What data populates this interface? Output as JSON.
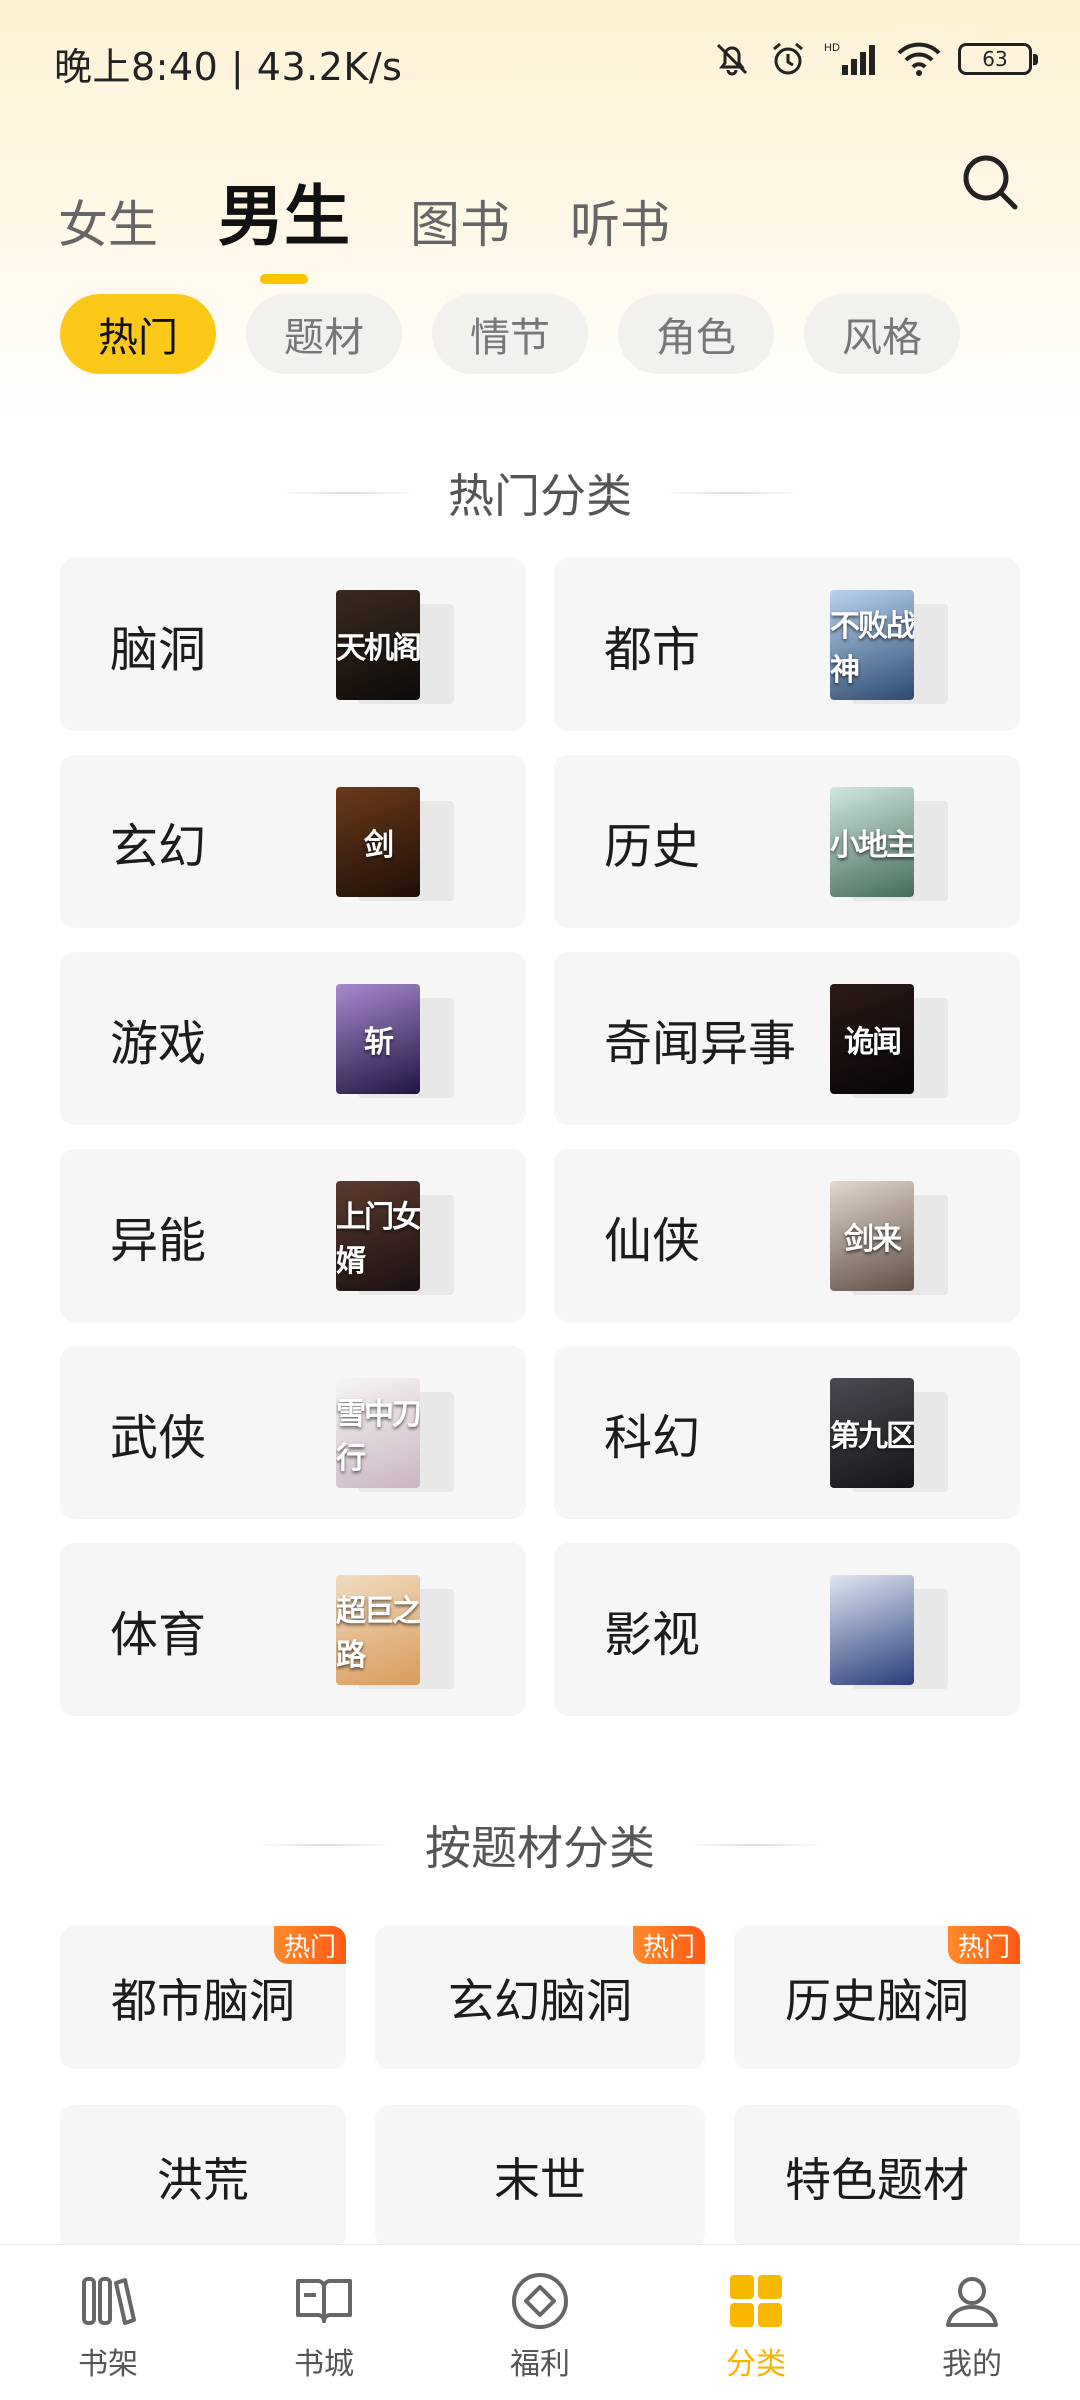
{
  "status": {
    "time": "晚上8:40 | 43.2K/s",
    "battery": "63"
  },
  "tabs": [
    {
      "label": "女生",
      "active": false
    },
    {
      "label": "男生",
      "active": true
    },
    {
      "label": "图书",
      "active": false
    },
    {
      "label": "听书",
      "active": false
    }
  ],
  "filters": [
    "热门",
    "题材",
    "情节",
    "角色",
    "风格"
  ],
  "sections": {
    "hot": "热门分类",
    "topic": "按题材分类"
  },
  "categories": [
    {
      "label": "脑洞",
      "cover_text": "天机阁",
      "cover_colors": [
        "#3a2a1f",
        "#0d0b0a"
      ]
    },
    {
      "label": "都市",
      "cover_text": "不败战神",
      "cover_colors": [
        "#b9d3ef",
        "#2d4a6f"
      ]
    },
    {
      "label": "玄幻",
      "cover_text": "剑",
      "cover_colors": [
        "#6a3a1a",
        "#1e0f08"
      ]
    },
    {
      "label": "历史",
      "cover_text": "小地主",
      "cover_colors": [
        "#cfe8de",
        "#466b58"
      ]
    },
    {
      "label": "游戏",
      "cover_text": "斩",
      "cover_colors": [
        "#a78ad0",
        "#201540"
      ]
    },
    {
      "label": "奇闻异事",
      "cover_text": "诡闻",
      "cover_colors": [
        "#2a1a17",
        "#080606"
      ]
    },
    {
      "label": "异能",
      "cover_text": "上门女婿",
      "cover_colors": [
        "#5b3a2e",
        "#191012"
      ]
    },
    {
      "label": "仙侠",
      "cover_text": "剑来",
      "cover_colors": [
        "#e2d8cc",
        "#5f4f48"
      ]
    },
    {
      "label": "武侠",
      "cover_text": "雪中刀行",
      "cover_colors": [
        "#f7f4f4",
        "#c9b6c2"
      ]
    },
    {
      "label": "科幻",
      "cover_text": "第九区",
      "cover_colors": [
        "#4a4a52",
        "#141418"
      ]
    },
    {
      "label": "体育",
      "cover_text": "超巨之路",
      "cover_colors": [
        "#f0dcc0",
        "#d99b5b"
      ]
    },
    {
      "label": "影视",
      "cover_text": "",
      "cover_colors": [
        "#dfe6f2",
        "#2a3d7a"
      ]
    }
  ],
  "subtopics": [
    {
      "label": "都市脑洞",
      "badge": "热门"
    },
    {
      "label": "玄幻脑洞",
      "badge": "热门"
    },
    {
      "label": "历史脑洞",
      "badge": "热门"
    },
    {
      "label": "洪荒",
      "badge": ""
    },
    {
      "label": "末世",
      "badge": ""
    },
    {
      "label": "特色题材",
      "badge": ""
    }
  ],
  "bottom_nav": [
    {
      "label": "书架",
      "icon": "bookshelf-icon",
      "active": false
    },
    {
      "label": "书城",
      "icon": "open-book-icon",
      "active": false
    },
    {
      "label": "福利",
      "icon": "welfare-diamond-icon",
      "active": false
    },
    {
      "label": "分类",
      "icon": "category-grid-icon",
      "active": true
    },
    {
      "label": "我的",
      "icon": "profile-icon",
      "active": false
    }
  ],
  "colors": {
    "accent": "#fcc81a",
    "hot_badge": "#ff6a1a"
  }
}
